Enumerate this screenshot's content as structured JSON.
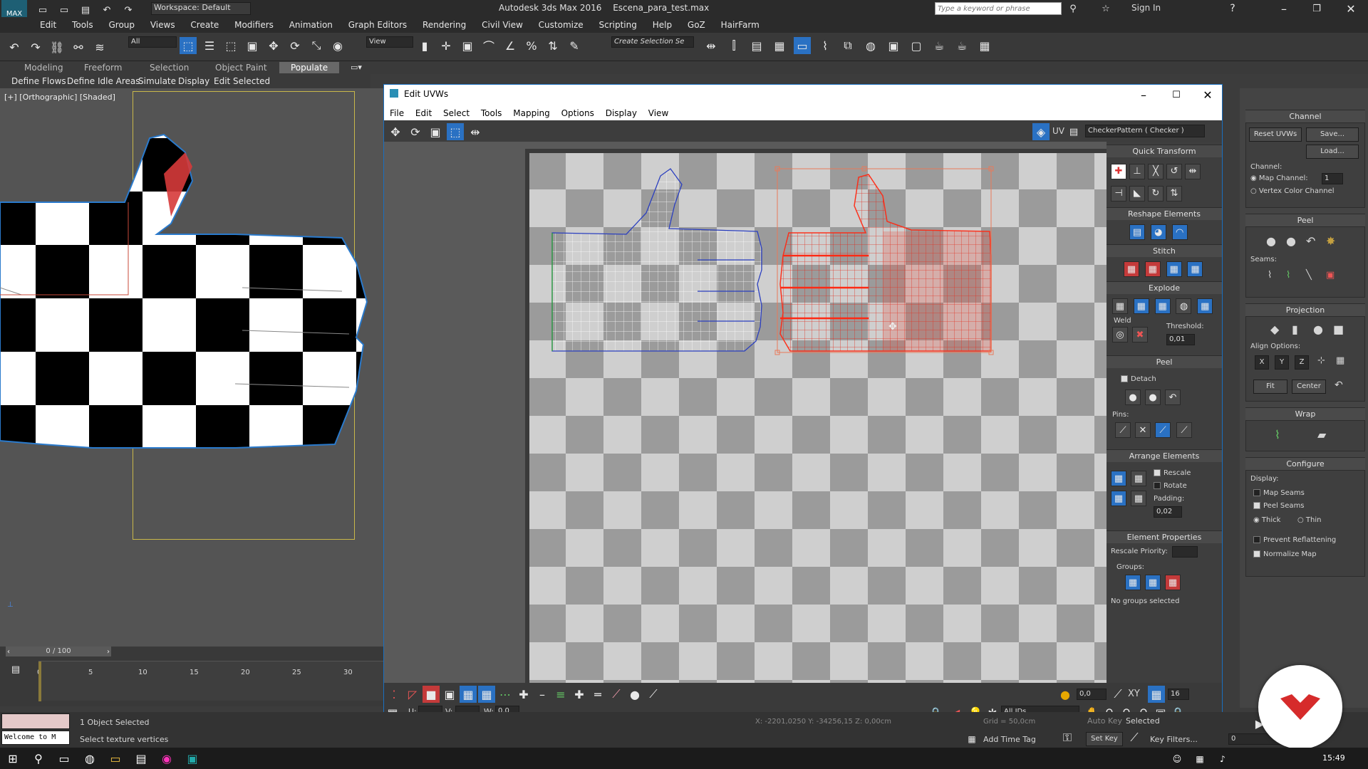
{
  "app": {
    "title": "Autodesk 3ds Max 2016",
    "file": "Escena_para_test.max",
    "workspace": "Workspace: Default",
    "search_placeholder": "Type a keyword or phrase",
    "sign_in": "Sign In",
    "menu": [
      "Edit",
      "Tools",
      "Group",
      "Views",
      "Create",
      "Modifiers",
      "Animation",
      "Graph Editors",
      "Rendering",
      "Civil View",
      "Customize",
      "Scripting",
      "Help",
      "GoZ",
      "HairFarm"
    ]
  },
  "toolbar": {
    "filter": "All",
    "refcoord": "View",
    "selection_set": "Create Selection Se"
  },
  "ribbon": {
    "tabs": [
      "Modeling",
      "Freeform",
      "Selection",
      "Object Paint",
      "Populate"
    ],
    "active_tab": "Populate",
    "sub_items": [
      "Define Flows",
      "Define Idle Areas",
      "Simulate",
      "Display",
      "Edit Selected"
    ]
  },
  "viewport": {
    "label": "[+] [Orthographic] [Shaded]"
  },
  "timeline": {
    "frame": "0 / 100",
    "ticks": [
      "0",
      "5",
      "10",
      "15",
      "20",
      "25",
      "30"
    ]
  },
  "status": {
    "welcome": "Welcome to M",
    "selected": "1 Object Selected",
    "hint": "Select texture vertices",
    "add_time_tag": "Add Time Tag",
    "auto_key": "Auto Key",
    "set_key": "Set Key",
    "key_filters": "Key Filters...",
    "selected_dd": "Selected",
    "time_field": "0",
    "coords": "X: -2201,0250  Y: -34256,15  Z: 0,00cm",
    "grid": "Grid = 50,0cm"
  },
  "taskbar": {
    "clock": "15:49"
  },
  "uv_editor": {
    "title": "Edit UVWs",
    "menu": [
      "File",
      "Edit",
      "Select",
      "Tools",
      "Mapping",
      "Options",
      "Display",
      "View"
    ],
    "uv_label": "UV",
    "checker": "CheckerPattern  ( Checker )",
    "quick_transform": "Quick Transform",
    "reshape": "Reshape Elements",
    "stitch": "Stitch",
    "explode": "Explode",
    "weld": "Weld",
    "threshold_label": "Threshold:",
    "threshold": "0,01",
    "peel": "Peel",
    "detach": "Detach",
    "pins": "Pins:",
    "arrange": "Arrange Elements",
    "rescale": "Rescale",
    "rotate": "Rotate",
    "padding_label": "Padding:",
    "padding": "0,02",
    "element_props": "Element Properties",
    "rescale_priority": "Rescale Priority:",
    "groups": "Groups:",
    "no_groups": "No groups selected",
    "bottom": {
      "value": "0,0",
      "xy": "XY",
      "grid_val": "16",
      "u_label": "U:",
      "v_label": "V:",
      "w_label": "W:",
      "w_value": "0,0",
      "ids": "All IDs"
    }
  },
  "cmd_panel": {
    "channel": "Channel",
    "reset_uvws": "Reset UVWs",
    "save": "Save...",
    "load": "Load...",
    "channel_label": "Channel:",
    "map_channel": "Map Channel:",
    "map_channel_val": "1",
    "vertex_color": "Vertex Color Channel",
    "peel": "Peel",
    "seams": "Seams:",
    "projection": "Projection",
    "align_options": "Align Options:",
    "align": [
      "X",
      "Y",
      "Z"
    ],
    "fit": "Fit",
    "center": "Center",
    "wrap": "Wrap",
    "configure": "Configure",
    "display": "Display:",
    "map_seams": "Map Seams",
    "peel_seams": "Peel Seams",
    "thick": "Thick",
    "thin": "Thin",
    "prevent": "Prevent Reflattening",
    "normalize": "Normalize Map"
  },
  "colors": {
    "accent": "#2a71c3",
    "selection_red": "#e02a1a",
    "brand_red": "#d62b2b"
  }
}
